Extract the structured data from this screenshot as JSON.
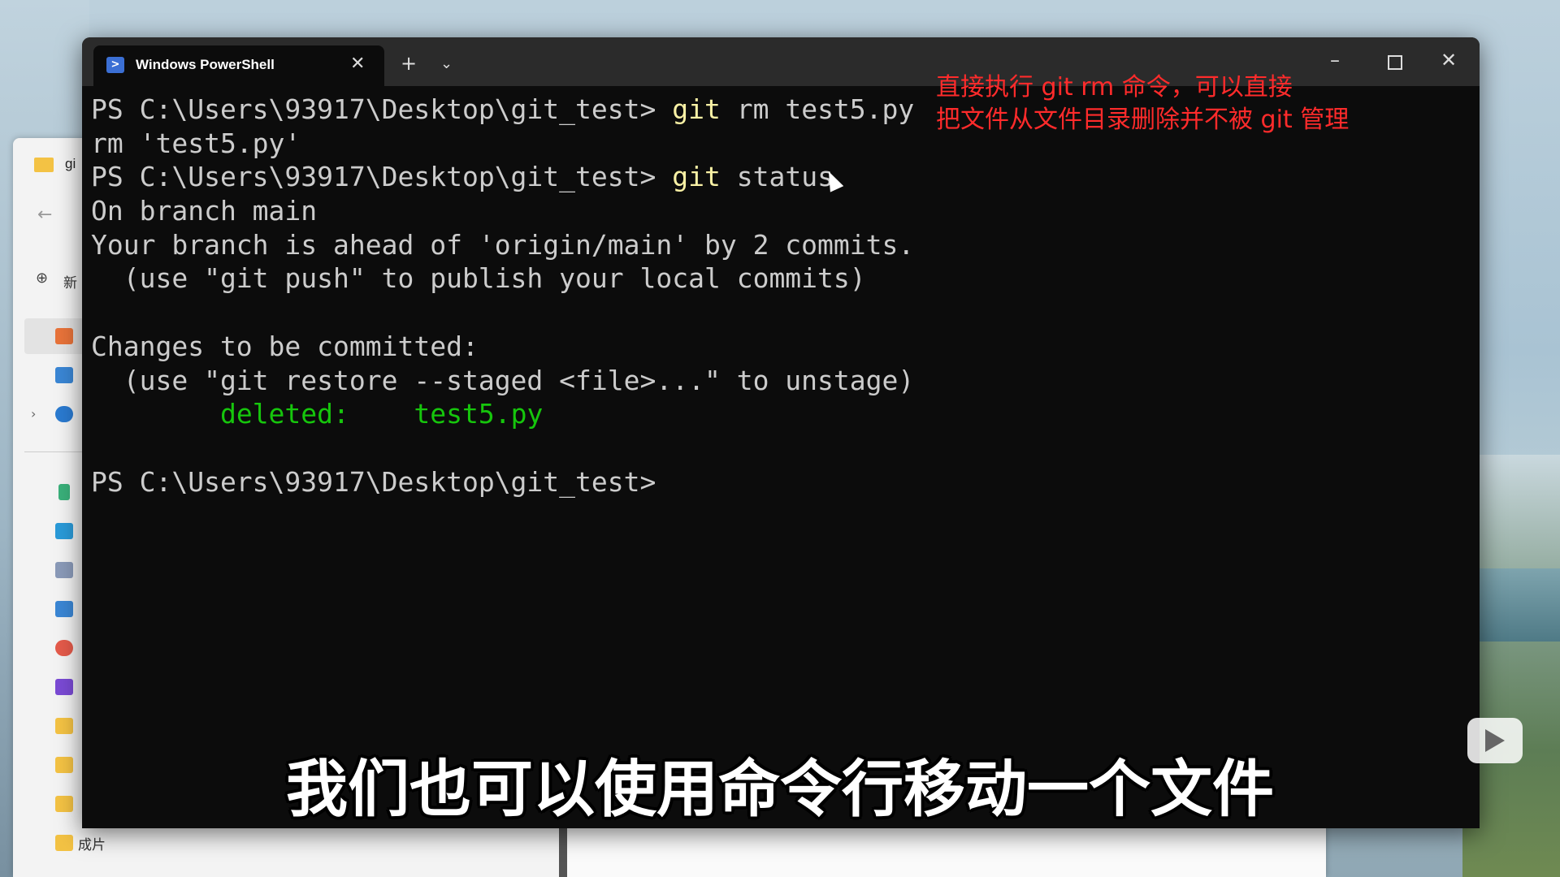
{
  "explorer": {
    "tab_label": "gi",
    "new_label": "新",
    "bottom_folder_label": "成片"
  },
  "terminal": {
    "tab_title": "Windows PowerShell",
    "lines": [
      {
        "text": "PS C:\\Users\\93917\\Desktop\\git_test> ",
        "cmd": "git",
        "rest": " rm test5.py"
      },
      {
        "text": "rm 'test5.py'",
        "cmd": "",
        "rest": ""
      },
      {
        "text": "PS C:\\Users\\93917\\Desktop\\git_test> ",
        "cmd": "git",
        "rest": " status"
      },
      {
        "text": "On branch main",
        "cmd": "",
        "rest": ""
      },
      {
        "text": "Your branch is ahead of 'origin/main' by 2 commits.",
        "cmd": "",
        "rest": ""
      },
      {
        "text": "  (use \"git push\" to publish your local commits)",
        "cmd": "",
        "rest": ""
      },
      {
        "text": "",
        "cmd": "",
        "rest": ""
      },
      {
        "text": "Changes to be committed:",
        "cmd": "",
        "rest": ""
      },
      {
        "text": "  (use \"git restore --staged <file>...\" to unstage)",
        "cmd": "",
        "rest": ""
      },
      {
        "text": "        ",
        "green": "deleted:    test5.py"
      },
      {
        "text": "",
        "cmd": "",
        "rest": ""
      },
      {
        "text": "PS C:\\Users\\93917\\Desktop\\git_test>",
        "cmd": "",
        "rest": ""
      }
    ]
  },
  "annotation": {
    "text": "直接执行 git rm 命令，可以直接\n把文件从文件目录删除并不被 git 管理"
  },
  "subtitle": {
    "text": "我们也可以使用命令行移动一个文件"
  },
  "colors": {
    "terminal_bg": "#0c0c0c",
    "command_yellow": "#f9f1a5",
    "status_green": "#16c60c",
    "annotation_red": "#ff2b2b"
  }
}
